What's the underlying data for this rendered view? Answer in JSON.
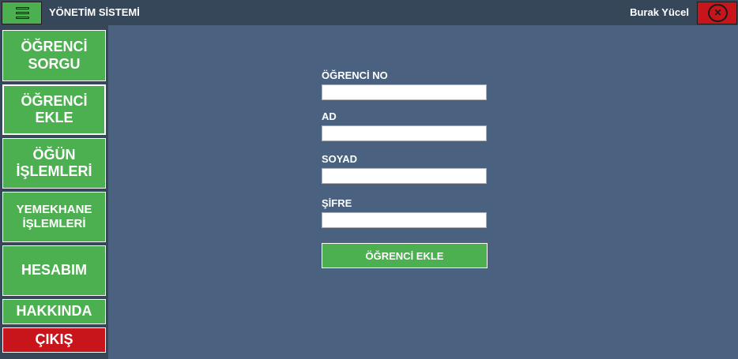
{
  "app": {
    "title": "YÖNETİM SİSTEMİ",
    "user_name": "Burak Yücel",
    "menu_icon": "hamburger-icon",
    "close_icon": "close-circle-icon"
  },
  "sidebar": {
    "items": [
      {
        "label_line1": "ÖĞRENCİ",
        "label_line2": "SORGU"
      },
      {
        "label_line1": "ÖĞRENCİ",
        "label_line2": "EKLE"
      },
      {
        "label_line1": "ÖĞÜN",
        "label_line2": "İŞLEMLERİ"
      },
      {
        "label_line1": "YEMEKHANE",
        "label_line2": "İŞLEMLERİ"
      },
      {
        "label_line1": "HESABIM"
      },
      {
        "label_line1": "HAKKINDA"
      },
      {
        "label_line1": "ÇIKIŞ"
      }
    ]
  },
  "form": {
    "fields": [
      {
        "label": "ÖĞRENCİ NO",
        "value": ""
      },
      {
        "label": "AD",
        "value": ""
      },
      {
        "label": "SOYAD",
        "value": ""
      },
      {
        "label": "ŞİFRE",
        "value": ""
      }
    ],
    "submit_label": "ÖĞRENCİ EKLE"
  },
  "colors": {
    "titlebar": "#354759",
    "content_bg": "#4a627f",
    "accent_green": "#4caf50",
    "exit_red": "#c8151c"
  }
}
